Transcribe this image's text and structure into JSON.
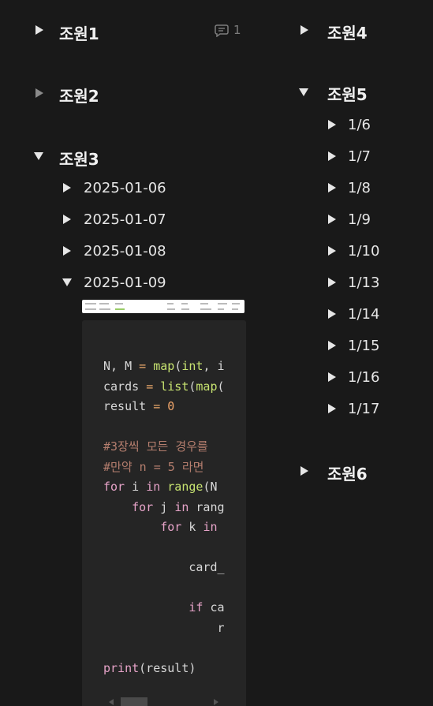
{
  "left": {
    "groups": [
      {
        "label": "조원1",
        "comment_count": "1"
      },
      {
        "label": "조원2"
      },
      {
        "label": "조원3",
        "children": [
          "2025-01-06",
          "2025-01-07",
          "2025-01-08",
          "2025-01-09"
        ]
      }
    ]
  },
  "right": {
    "groups": [
      {
        "label": "조원4"
      },
      {
        "label": "조원5",
        "children": [
          "1/6",
          "1/7",
          "1/8",
          "1/9",
          "1/10",
          "1/13",
          "1/14",
          "1/15",
          "1/16",
          "1/17"
        ]
      },
      {
        "label": "조원6"
      }
    ]
  },
  "code": {
    "language": "python",
    "lines": [
      "N, M = map(int, i",
      "cards = list(map(",
      "result = 0",
      "",
      "#3장씩 모든 경우를",
      "#만약 n = 5 라면",
      "for i in range(N",
      "    for j in rang",
      "        for k in",
      "",
      "            card_",
      "",
      "            if ca",
      "                r",
      "",
      "print(result)"
    ]
  },
  "colors": {
    "background": "#191919",
    "code_background": "#252525",
    "keyword": "#e6a3c8",
    "function": "#c7e370",
    "number": "#f1a66b",
    "comment": "#b57e6e"
  }
}
